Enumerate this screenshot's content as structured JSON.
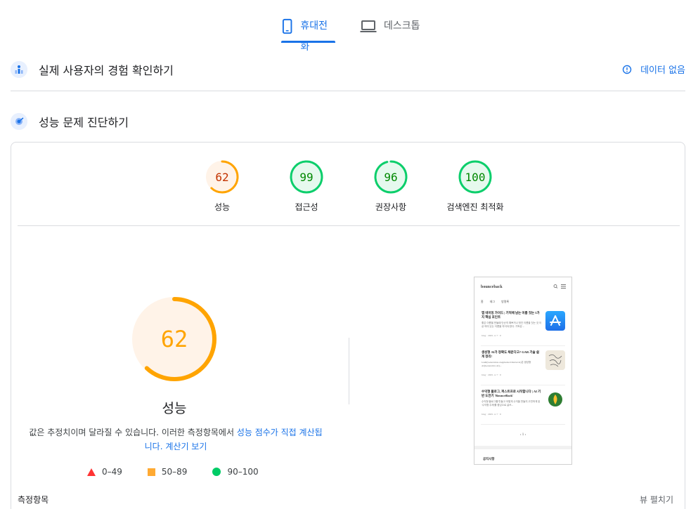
{
  "tabs": [
    {
      "label": "휴대전화",
      "active": true,
      "icon": "smartphone-icon"
    },
    {
      "label": "데스크톱",
      "active": false,
      "icon": "laptop-icon"
    }
  ],
  "crux": {
    "title": "실제 사용자의 경험 확인하기",
    "no_data_label": "데이터 없음"
  },
  "diagnostics": {
    "title": "성능 문제 진단하기",
    "gauges": [
      {
        "score": "62",
        "value": 0.62,
        "label": "성능",
        "status": "average"
      },
      {
        "score": "99",
        "value": 0.99,
        "label": "접근성",
        "status": "pass"
      },
      {
        "score": "96",
        "value": 0.96,
        "label": "권장사항",
        "status": "pass"
      },
      {
        "score": "100",
        "value": 1.0,
        "label": "검색엔진 최적화",
        "status": "pass"
      }
    ],
    "main_score": {
      "score": "62",
      "value": 0.62,
      "title": "성능"
    },
    "description_text": "값은 추정치이며 달라질 수 있습니다. 이러한 측정항목에서 ",
    "description_link1": "성능 점수가 직접 계산됩니다.",
    "description_link2": "계산기 보기",
    "legend": [
      {
        "range": "0–49",
        "shape": "triangle",
        "color": "#ff3333"
      },
      {
        "range": "50–89",
        "shape": "square",
        "color": "#ffaa33"
      },
      {
        "range": "90–100",
        "shape": "circle",
        "color": "#00cc66"
      }
    ],
    "metrics_label": "측정항목",
    "expand_label": "뷰 펼치기"
  },
  "colors": {
    "accent": "#1a73e8",
    "average": "#ffa400",
    "average_text": "#c33300",
    "average_bg": "#fff3e8",
    "pass": "#0cce6b",
    "pass_text": "#008800",
    "pass_bg": "#e6f9ee"
  },
  "phone_preview": {
    "brand": "bounceback",
    "menu": [
      "홈",
      "태그",
      "방명록"
    ],
    "posts": [
      {
        "title": "앱 네이밍 가이드 | 기억에 남는 이름 짓는 5가지 핵심 포인트",
        "snippet": "좋은 이름을 만들때 단순히 예쁘거나 멋진 이름을 짓는 것 이상 의미 있는 이름을 지어야 한다. 가독성 ...",
        "meta": "blog · 2025. 4. 7 · 0",
        "thumb": "app-store-icon"
      },
      {
        "title": "생성형 AI가 정확도 채운다고? GAR 기술 쉽게 정리!",
        "snippet": "GAR(Generation-Augmented Retrieval)은 생성형 AI(Generative AI)...",
        "meta": "blog · 2025. 4. 7 · 0",
        "thumb": "sketch-image"
      },
      {
        "title": "수익형 플로그, 퍼스트프로 시작합니다 | AI 기반 도전기 'BounceBack'",
        "snippet": "수익형 블로그를 만들고 어떻게 수익을 만들지 고민하게 된 '수익형 주제'를 중심으로 글쓰...",
        "meta": "blog · 2025. 4. 7 · 0",
        "thumb": "leaf-logo"
      }
    ],
    "pager": "‹   1   ›",
    "footer": "공지사항"
  }
}
